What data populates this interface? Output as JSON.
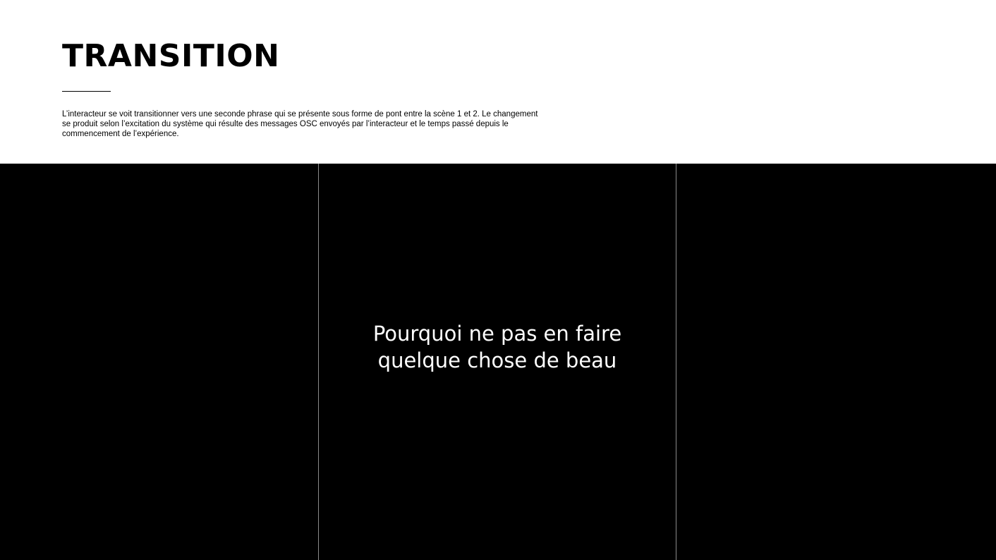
{
  "slide": {
    "title": "TRANSITION",
    "description_lines": [
      "L’interacteur se voit transitionner vers une seconde phrase qui se présente sous forme de pont entre la scène 1 et 2. Le changement",
      "se produit selon l’excitation du système qui résulte des messages OSC envoyés par l’interacteur et le temps passé depuis le",
      "commencement de l’expérience."
    ]
  },
  "stage": {
    "phrase_lines": [
      "Pourquoi ne pas en faire",
      "quelque chose de beau"
    ]
  },
  "colors": {
    "background": "#ffffff",
    "text": "#000000",
    "stage_background": "#000000",
    "stage_text": "#ffffff",
    "divider": "#8a8a8a"
  }
}
